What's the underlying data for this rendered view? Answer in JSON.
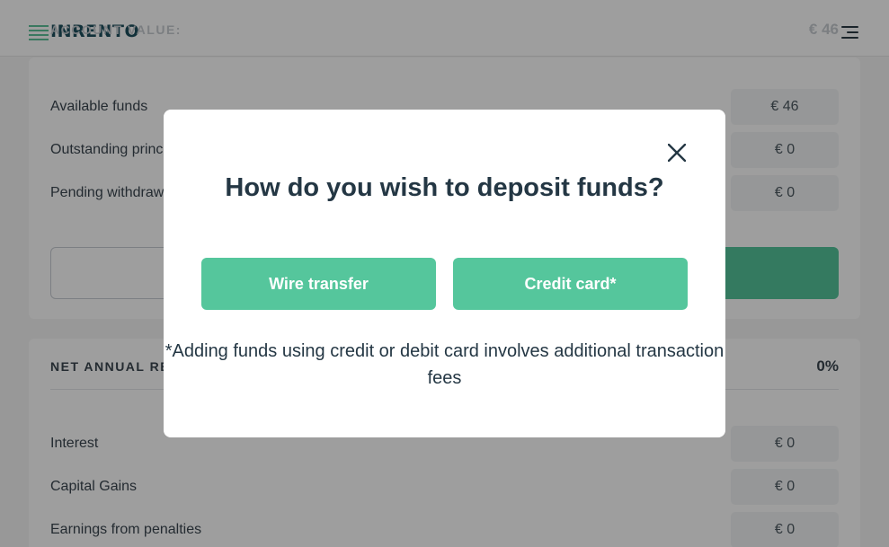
{
  "header": {
    "logo_text": "INRENTO",
    "menu_icon": "hamburger-menu-icon"
  },
  "account": {
    "label": "ACCOUNT VALUE:",
    "value": "€ 46",
    "rows": [
      {
        "label": "Available funds",
        "value": "€ 46"
      },
      {
        "label": "Outstanding principal",
        "value": "€ 0"
      },
      {
        "label": "Pending withdrawals",
        "value": "€ 0"
      }
    ]
  },
  "returns": {
    "label": "NET ANNUAL RETURN",
    "value": "0%",
    "rows": [
      {
        "label": "Interest",
        "value": "€ 0"
      },
      {
        "label": "Capital Gains",
        "value": "€ 0"
      },
      {
        "label": "Earnings from penalties",
        "value": "€ 0"
      }
    ]
  },
  "modal": {
    "title": "How do you wish to deposit funds?",
    "wire_label": "Wire transfer",
    "card_label": "Credit card*",
    "note": "*Adding funds using credit or debit card involves additional transaction fees",
    "close_icon": "close-icon"
  },
  "colors": {
    "accent": "#55c69c",
    "heading": "#243744"
  }
}
